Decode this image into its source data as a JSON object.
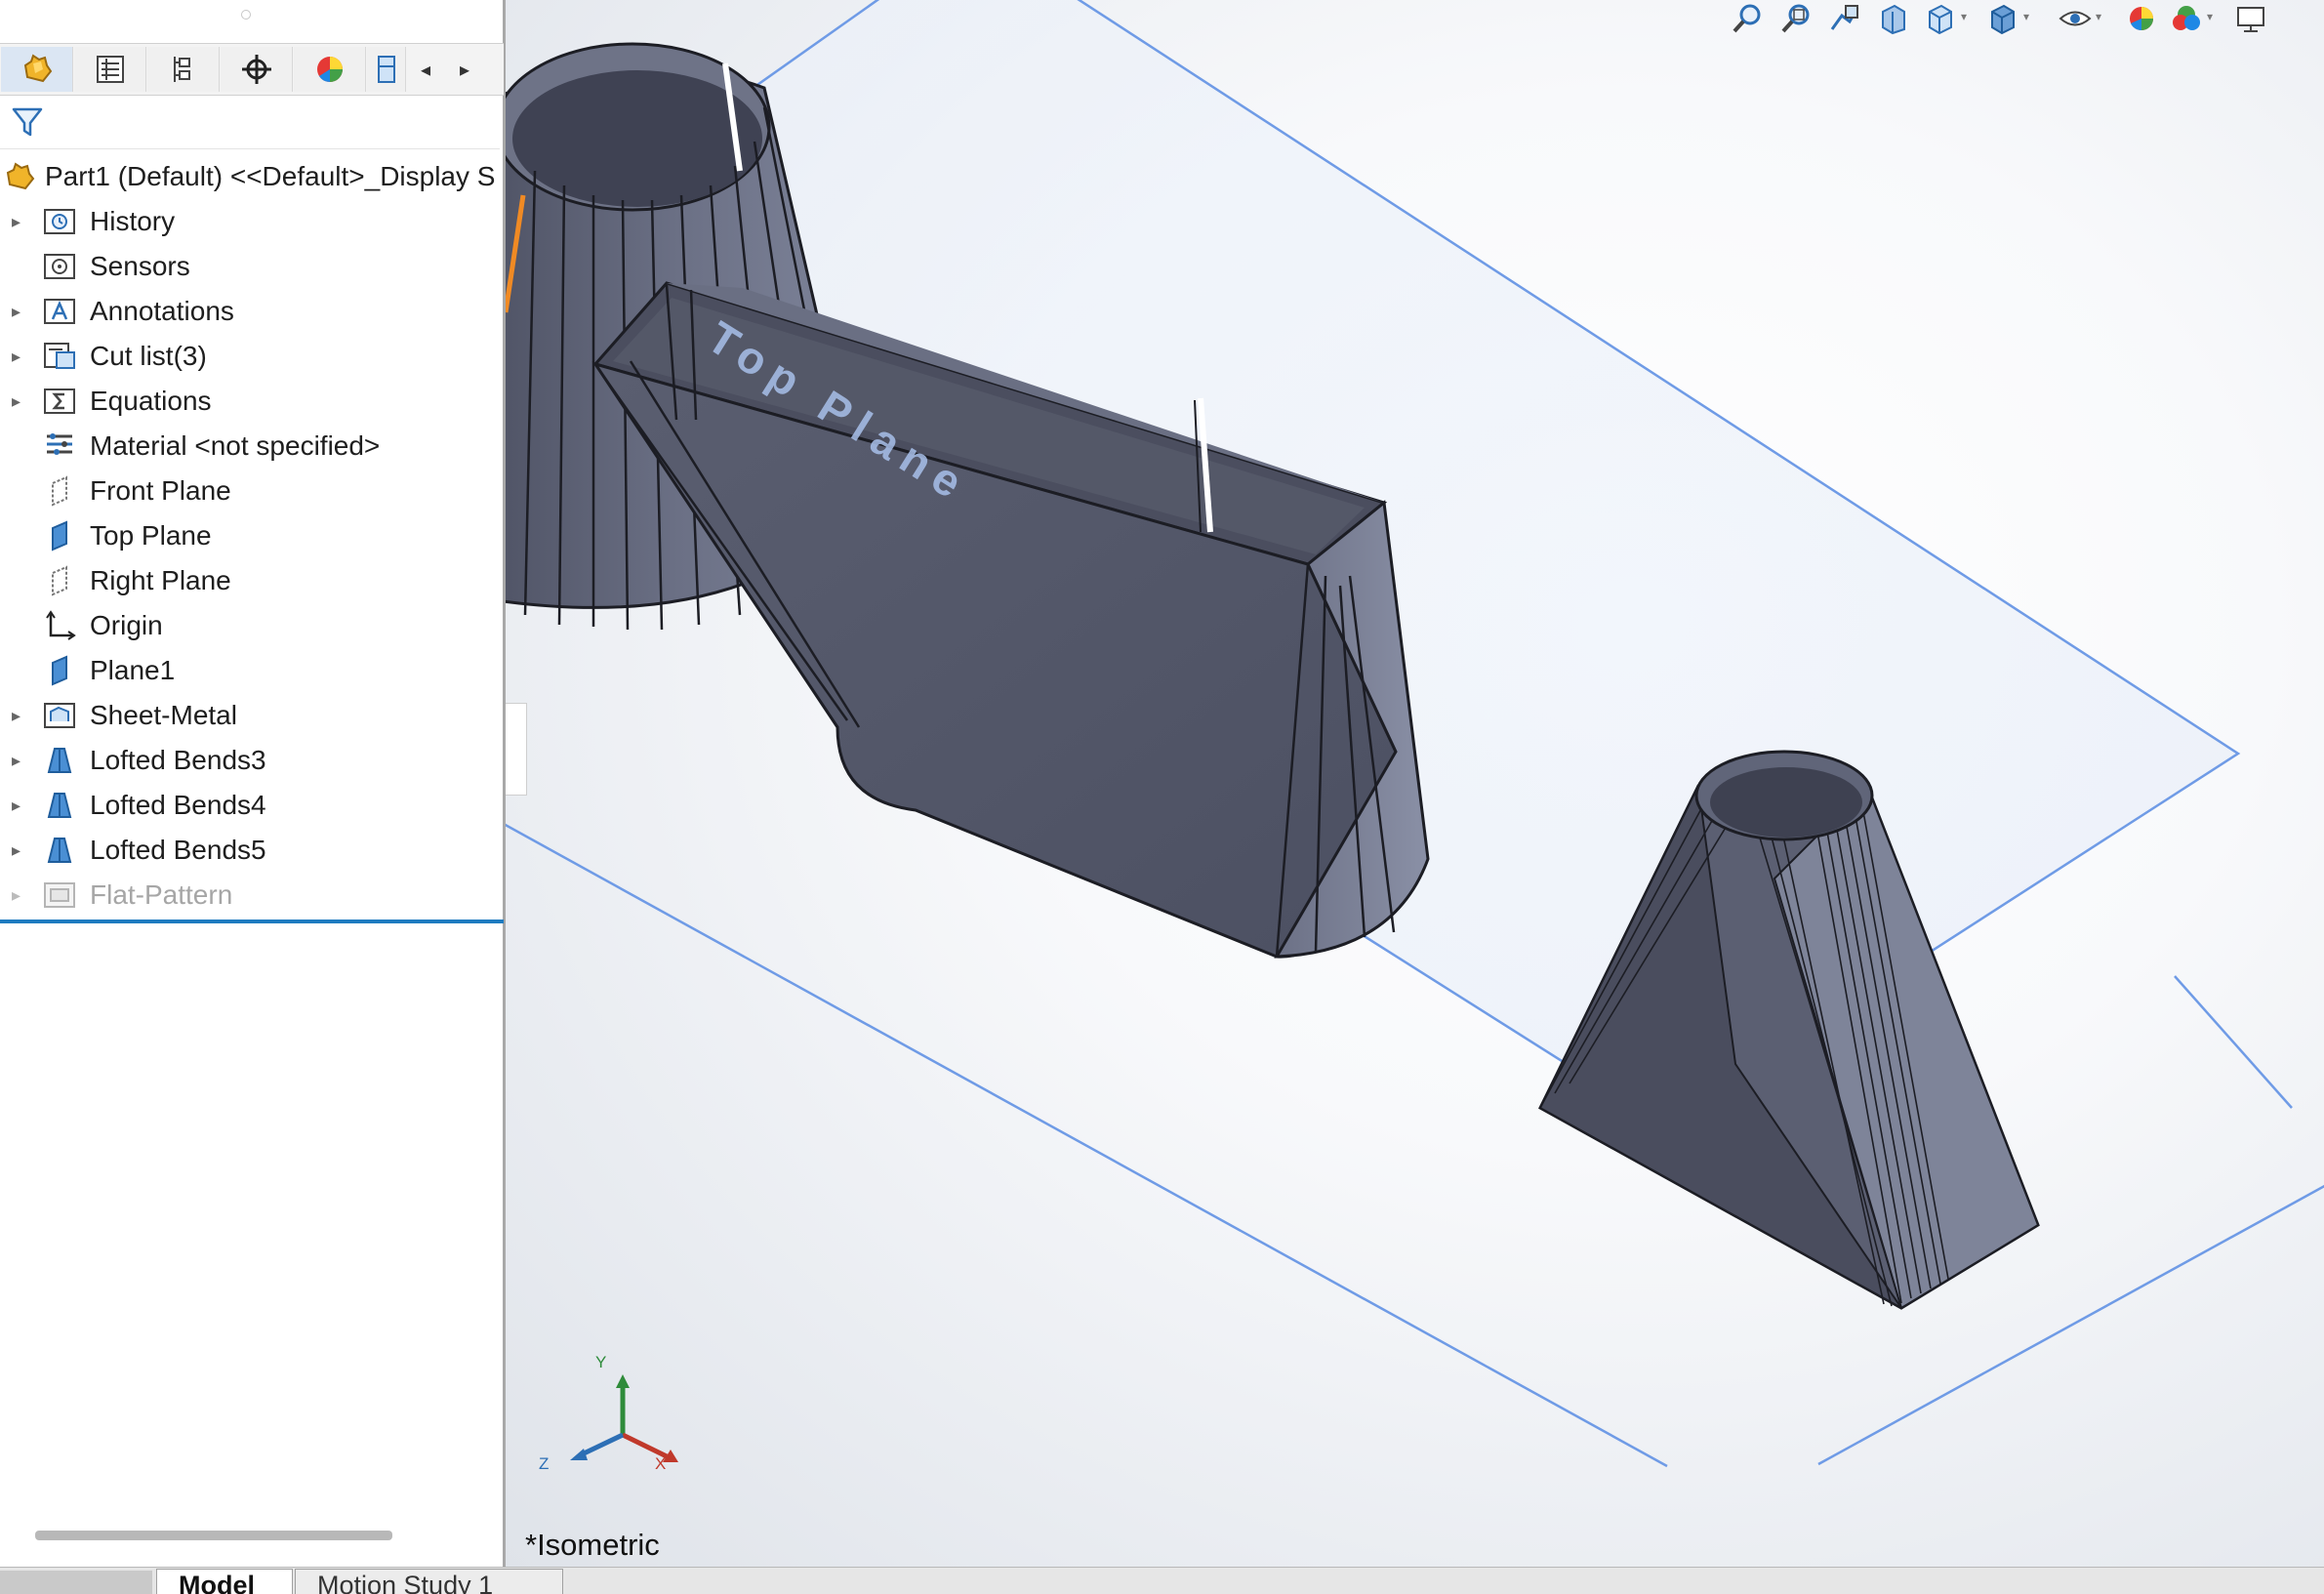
{
  "feature_tree": {
    "root_label": "Part1 (Default) <<Default>_Display S",
    "items": [
      {
        "label": "History",
        "icon": "history-folder-icon",
        "expandable": true
      },
      {
        "label": "Sensors",
        "icon": "sensors-folder-icon",
        "expandable": false
      },
      {
        "label": "Annotations",
        "icon": "annotations-folder-icon",
        "expandable": true
      },
      {
        "label": "Cut list(3)",
        "icon": "cut-list-icon",
        "expandable": true
      },
      {
        "label": "Equations",
        "icon": "equations-folder-icon",
        "expandable": true
      },
      {
        "label": "Material <not specified>",
        "icon": "material-icon",
        "expandable": false
      },
      {
        "label": "Front Plane",
        "icon": "plane-icon",
        "expandable": false
      },
      {
        "label": "Top Plane",
        "icon": "plane-icon",
        "expandable": false
      },
      {
        "label": "Right Plane",
        "icon": "plane-icon",
        "expandable": false
      },
      {
        "label": "Origin",
        "icon": "origin-icon",
        "expandable": false
      },
      {
        "label": "Plane1",
        "icon": "plane-icon",
        "expandable": false
      },
      {
        "label": "Sheet-Metal",
        "icon": "sheet-metal-icon",
        "expandable": true
      },
      {
        "label": "Lofted Bends3",
        "icon": "lofted-bends-icon",
        "expandable": true
      },
      {
        "label": "Lofted Bends4",
        "icon": "lofted-bends-icon",
        "expandable": true
      },
      {
        "label": "Lofted Bends5",
        "icon": "lofted-bends-icon",
        "expandable": true
      },
      {
        "label": "Flat-Pattern",
        "icon": "flat-pattern-icon",
        "expandable": true
      }
    ]
  },
  "panel_tabs": [
    "featuremanager-icon",
    "propertymanager-icon",
    "configurationmanager-icon",
    "dimxpert-icon",
    "display-manager-icon",
    "cam-icon"
  ],
  "viewport": {
    "view_name": "*Isometric",
    "plane_label": "Top Plane",
    "triad": {
      "x": "X",
      "y": "Y",
      "z": "Z"
    }
  },
  "bottom_tabs": {
    "model": "Model",
    "motion": "Motion Study 1"
  },
  "colors": {
    "accent_blue": "#1e7bc0",
    "plane_edge": "#6f9be6",
    "part_body": "#5e6274",
    "part_dark": "#3f4253",
    "part_light": "#848aa0"
  }
}
